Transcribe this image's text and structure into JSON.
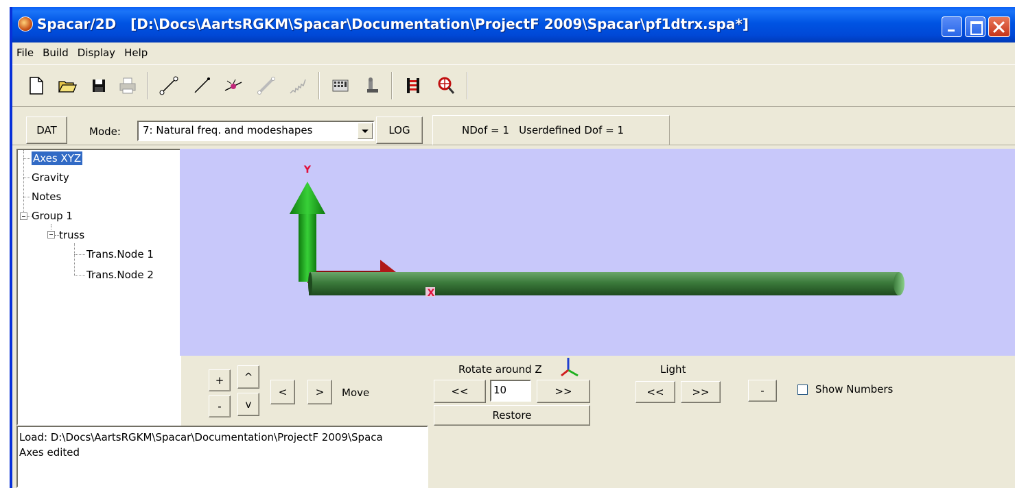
{
  "window": {
    "app_name": "Spacar/2D",
    "file_path": "[D:\\Docs\\AartsRGKM\\Spacar\\Documentation\\ProjectF 2009\\Spacar\\pf1dtrx.spa*]"
  },
  "menu": [
    "File",
    "Build",
    "Display",
    "Help"
  ],
  "toolbar": {
    "icons": [
      "new-file-icon",
      "open-folder-icon",
      "save-icon",
      "print-icon",
      "add-node-icon",
      "add-element-icon",
      "add-constraint-icon",
      "add-beam-icon",
      "add-spring-icon",
      "calculator-icon",
      "run-icon",
      "results-icon",
      "zoom-icon"
    ]
  },
  "modebar": {
    "dat_label": "DAT",
    "mode_label": "Mode:",
    "mode_value": "7: Natural freq. and modeshapes",
    "log_label": "LOG",
    "ndof_text": "NDof = 1   Userdefined Dof = 1"
  },
  "tree": {
    "nodes": [
      "Axes XYZ",
      "Gravity",
      "Notes",
      "Group 1",
      "truss",
      "Trans.Node 1",
      "Trans.Node 2"
    ],
    "selected": "Axes XYZ"
  },
  "viewport": {
    "background": "#c8c8fa",
    "y_axis_label": "Y",
    "x_axis_label": "X",
    "y_axis_color": "#1aa01a",
    "x_axis_color": "#b01818",
    "truss_color": "#3b7a3b"
  },
  "controls": {
    "zoom_in": "+",
    "zoom_out": "-",
    "up": "^",
    "down": "v",
    "left": "<",
    "right": ">",
    "move_label": "Move",
    "rotate_label": "Rotate around Z",
    "rotate_left": "<<",
    "rotate_right": ">>",
    "rotate_angle": "10",
    "restore_label": "Restore",
    "light_label": "Light",
    "light_left": "<<",
    "light_right": ">>",
    "minus_label": "-",
    "show_numbers_label": "Show Numbers",
    "show_numbers_checked": false
  },
  "log": {
    "lines": [
      "Load: D:\\Docs\\AartsRGKM\\Spacar\\Documentation\\ProjectF 2009\\Spaca",
      "Axes edited"
    ]
  }
}
